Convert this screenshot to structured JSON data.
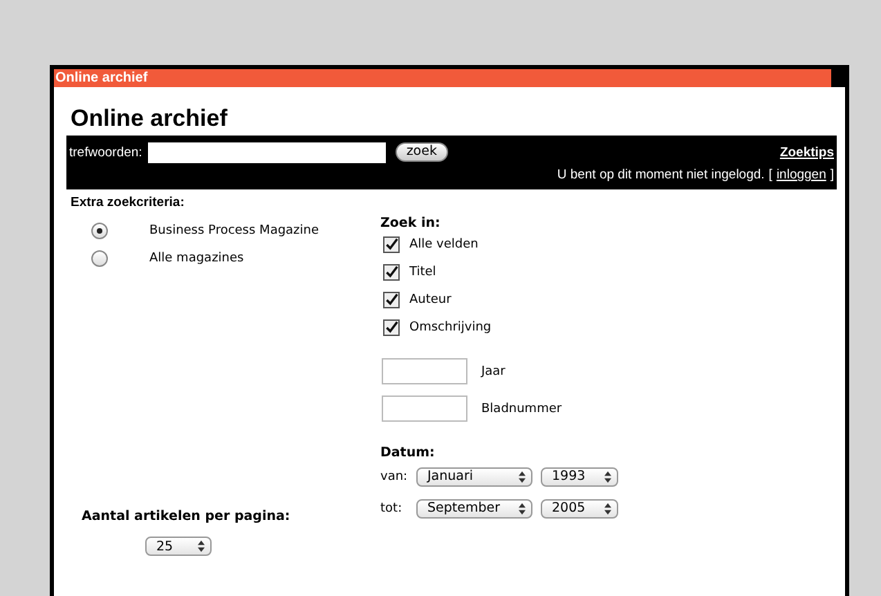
{
  "window": {
    "title": "Online archief"
  },
  "heading": "Online archief",
  "search": {
    "label": "trefwoorden:",
    "button": "zoek",
    "tips_link": "Zoektips"
  },
  "login": {
    "message": "U bent op dit moment niet ingelogd.",
    "bracket_open": "[",
    "link": "inloggen",
    "bracket_close": "]"
  },
  "extra_title": "Extra zoekcriteria:",
  "magazines": [
    {
      "label": "Business Process Magazine",
      "selected": true
    },
    {
      "label": "Alle magazines",
      "selected": false
    }
  ],
  "zoek_in": {
    "title": "Zoek in:",
    "options": [
      {
        "label": "Alle velden",
        "checked": true
      },
      {
        "label": "Titel",
        "checked": true
      },
      {
        "label": "Auteur",
        "checked": true
      },
      {
        "label": "Omschrijving",
        "checked": true
      }
    ]
  },
  "fields": [
    {
      "label": "Jaar"
    },
    {
      "label": "Bladnummer"
    }
  ],
  "datum": {
    "title": "Datum:",
    "rows": [
      {
        "label": "van:",
        "month": "Januari",
        "year": "1993"
      },
      {
        "label": "tot:",
        "month": "September",
        "year": "2005"
      }
    ]
  },
  "per_page": {
    "label": "Aantal artikelen per pagina:",
    "value": "25"
  }
}
